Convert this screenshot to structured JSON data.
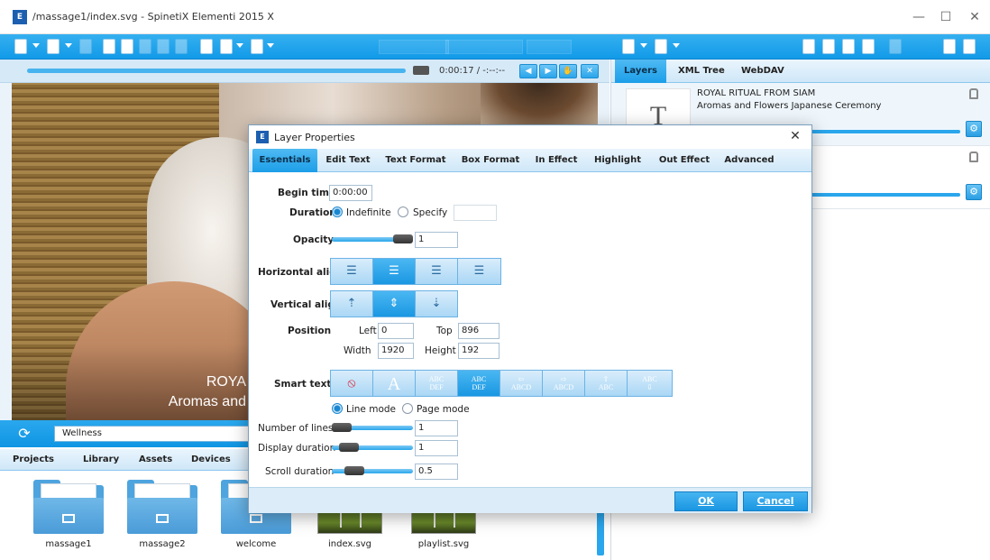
{
  "window": {
    "title": "/massage1/index.svg - SpinetiX Elementi 2015 X",
    "minimize": "—",
    "maximize": "☐",
    "close": "✕"
  },
  "preview": {
    "timecode": "0:00:17 / -:--:--",
    "overlay_title": "ROYA",
    "overlay_subtitle": "Aromas and"
  },
  "layers_panel": {
    "tabs": [
      "Layers",
      "XML Tree",
      "WebDAV"
    ],
    "active_tab": "Layers",
    "items": [
      {
        "title": "ROYAL RITUAL FROM SIAM",
        "subtitle": "Aromas and Flowers Japanese Ceremony",
        "thumb": "T"
      }
    ]
  },
  "browser": {
    "path": "Wellness",
    "tabs": [
      "Projects",
      "Library",
      "Assets",
      "Devices"
    ],
    "files": [
      {
        "name": "massage1",
        "kind": "folder"
      },
      {
        "name": "massage2",
        "kind": "folder"
      },
      {
        "name": "welcome",
        "kind": "folder"
      },
      {
        "name": "index.svg",
        "kind": "svg"
      },
      {
        "name": "playlist.svg",
        "kind": "svg"
      }
    ]
  },
  "dialog": {
    "title": "Layer Properties",
    "close": "✕",
    "tabs": [
      "Essentials",
      "Edit Text",
      "Text Format",
      "Box Format",
      "In Effect",
      "Highlight",
      "Out Effect",
      "Advanced"
    ],
    "active_tab": "Essentials",
    "begin_time_label": "Begin time",
    "begin_time_value": "0:00:00",
    "duration_label": "Duration",
    "duration_indefinite": "Indefinite",
    "duration_specify": "Specify",
    "duration_selected": "Indefinite",
    "opacity_label": "Opacity",
    "opacity_value": "1",
    "horizontal_align_label": "Horizontal align",
    "vertical_align_label": "Vertical align",
    "position_label": "Position",
    "left_label": "Left",
    "left_value": "0",
    "top_label": "Top",
    "top_value": "896",
    "width_label": "Width",
    "width_value": "1920",
    "height_label": "Height",
    "height_value": "192",
    "smart_text_label": "Smart text",
    "line_mode": "Line mode",
    "page_mode": "Page mode",
    "mode_selected": "Line mode",
    "number_of_lines_label": "Number of lines",
    "number_of_lines_value": "1",
    "display_duration_label": "Display duration",
    "display_duration_value": "1",
    "scroll_duration_label": "Scroll duration",
    "scroll_duration_value": "0.5",
    "ok": "OK",
    "cancel": "Cancel"
  },
  "colors": {
    "accent": "#1a97e2",
    "toolbar": "#129ae8"
  }
}
